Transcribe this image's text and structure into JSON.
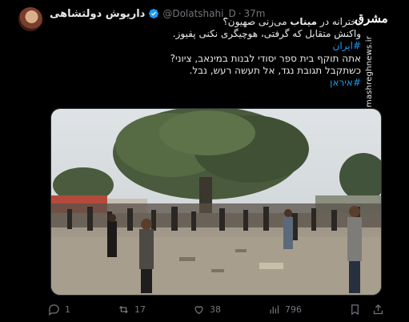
{
  "author": {
    "display_name": "داریوش دولتشاهی",
    "handle": "@Dolatshahi_D",
    "separator": "·",
    "time": "37m"
  },
  "body": {
    "line1_pre": "دخترانه در ",
    "line1_bold": "میناب",
    "line1_post": " می‌زنی صهیون؟",
    "line2": "واکنش متقابل که گرفتی، هوچیگری نکنی پفیوز.",
    "hashtag1": "#ایران",
    "line4": "אתה תוקף בית ספר יסודי לבנות במינאב, ציוני?",
    "line5": "כשתקבל תגובת נגד, אל תעשה רעש, נבל.",
    "hashtag2": "#איראן"
  },
  "watermark": {
    "logo": "مشرق",
    "url": "mashreghnews.ir"
  },
  "media": {
    "description_icon": "photo"
  },
  "actions": {
    "replies": "1",
    "reposts": "17",
    "likes": "38",
    "views": "796"
  },
  "colors": {
    "background": "#000000",
    "text": "#e7e9ea",
    "muted": "#71767b",
    "link": "#1d9bf0"
  }
}
